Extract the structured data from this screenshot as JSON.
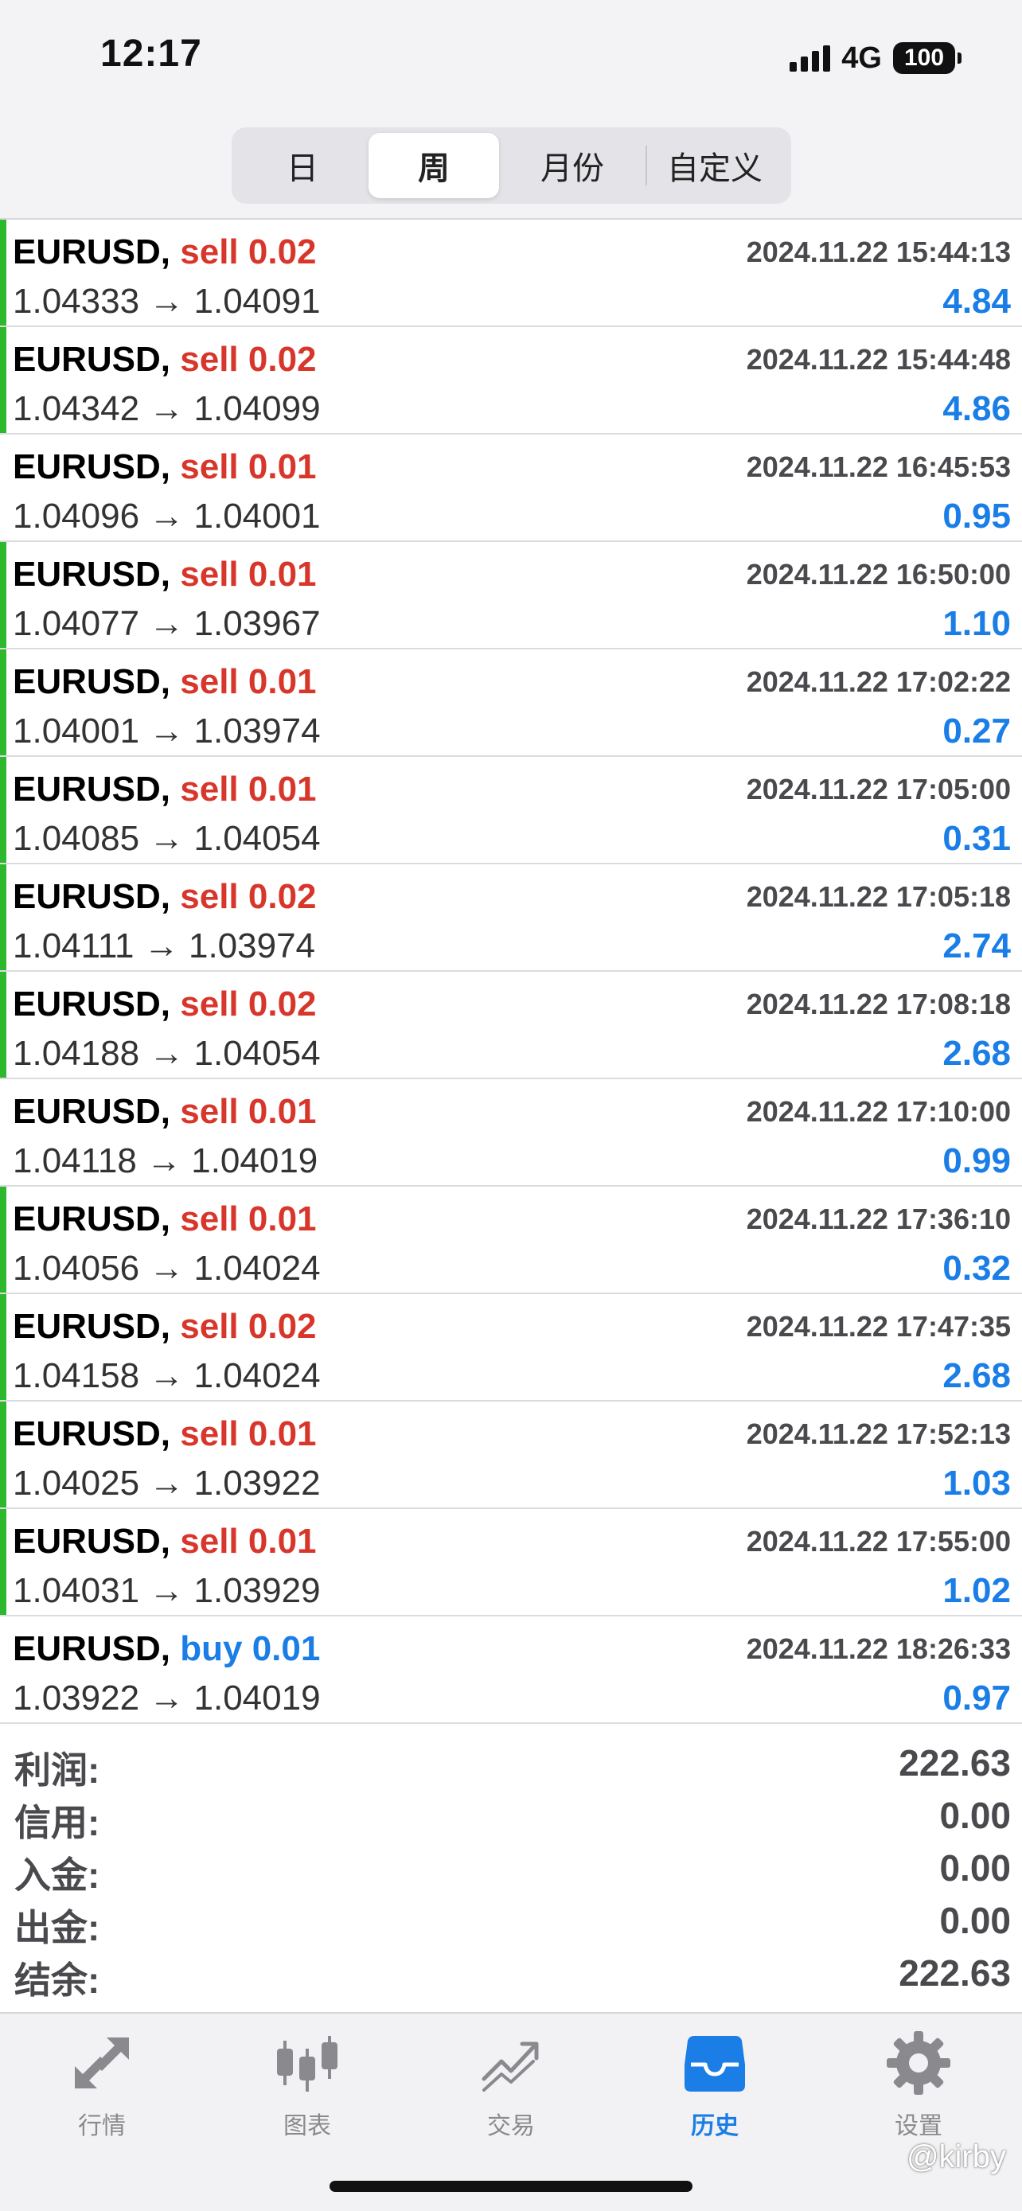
{
  "status_bar": {
    "time": "12:17",
    "network": "4G",
    "battery": "100"
  },
  "period_tabs": [
    {
      "label": "日",
      "active": false
    },
    {
      "label": "周",
      "active": true
    },
    {
      "label": "月份",
      "active": false
    },
    {
      "label": "自定义",
      "active": false
    }
  ],
  "trades": [
    {
      "symbol": "EURUSD,",
      "side": "sell 0.02",
      "time": "2024.11.22 15:44:13",
      "prices": "1.04333 → 1.04091",
      "profit": "4.84",
      "bar": true
    },
    {
      "symbol": "EURUSD,",
      "side": "sell 0.02",
      "time": "2024.11.22 15:44:48",
      "prices": "1.04342 → 1.04099",
      "profit": "4.86",
      "bar": true
    },
    {
      "symbol": "EURUSD,",
      "side": "sell 0.01",
      "time": "2024.11.22 16:45:53",
      "prices": "1.04096 → 1.04001",
      "profit": "0.95",
      "bar": false
    },
    {
      "symbol": "EURUSD,",
      "side": "sell 0.01",
      "time": "2024.11.22 16:50:00",
      "prices": "1.04077 → 1.03967",
      "profit": "1.10",
      "bar": true
    },
    {
      "symbol": "EURUSD,",
      "side": "sell 0.01",
      "time": "2024.11.22 17:02:22",
      "prices": "1.04001 → 1.03974",
      "profit": "0.27",
      "bar": true
    },
    {
      "symbol": "EURUSD,",
      "side": "sell 0.01",
      "time": "2024.11.22 17:05:00",
      "prices": "1.04085 → 1.04054",
      "profit": "0.31",
      "bar": true
    },
    {
      "symbol": "EURUSD,",
      "side": "sell 0.02",
      "time": "2024.11.22 17:05:18",
      "prices": "1.04111 → 1.03974",
      "profit": "2.74",
      "bar": true
    },
    {
      "symbol": "EURUSD,",
      "side": "sell 0.02",
      "time": "2024.11.22 17:08:18",
      "prices": "1.04188 → 1.04054",
      "profit": "2.68",
      "bar": true
    },
    {
      "symbol": "EURUSD,",
      "side": "sell 0.01",
      "time": "2024.11.22 17:10:00",
      "prices": "1.04118 → 1.04019",
      "profit": "0.99",
      "bar": false
    },
    {
      "symbol": "EURUSD,",
      "side": "sell 0.01",
      "time": "2024.11.22 17:36:10",
      "prices": "1.04056 → 1.04024",
      "profit": "0.32",
      "bar": true
    },
    {
      "symbol": "EURUSD,",
      "side": "sell 0.02",
      "time": "2024.11.22 17:47:35",
      "prices": "1.04158 → 1.04024",
      "profit": "2.68",
      "bar": true
    },
    {
      "symbol": "EURUSD,",
      "side": "sell 0.01",
      "time": "2024.11.22 17:52:13",
      "prices": "1.04025 → 1.03922",
      "profit": "1.03",
      "bar": true
    },
    {
      "symbol": "EURUSD,",
      "side": "sell 0.01",
      "time": "2024.11.22 17:55:00",
      "prices": "1.04031 → 1.03929",
      "profit": "1.02",
      "bar": true
    },
    {
      "symbol": "EURUSD,",
      "side": "buy 0.01",
      "time": "2024.11.22 18:26:33",
      "prices": "1.03922 → 1.04019",
      "profit": "0.97",
      "bar": false
    }
  ],
  "summary": [
    {
      "label": "利润:",
      "value": "222.63"
    },
    {
      "label": "信用:",
      "value": "0.00"
    },
    {
      "label": "入金:",
      "value": "0.00"
    },
    {
      "label": "出金:",
      "value": "0.00"
    },
    {
      "label": "结余:",
      "value": "222.63"
    }
  ],
  "tabbar": [
    {
      "label": "行情",
      "icon": "quotes-arrows-icon",
      "active": false
    },
    {
      "label": "图表",
      "icon": "candlestick-chart-icon",
      "active": false
    },
    {
      "label": "交易",
      "icon": "trade-chart-icon",
      "active": false
    },
    {
      "label": "历史",
      "icon": "history-inbox-icon",
      "active": true
    },
    {
      "label": "设置",
      "icon": "gear-icon",
      "active": false
    }
  ],
  "watermark": "@kirby",
  "colors": {
    "sell": "#d8362b",
    "buy": "#1a7ee6",
    "profit": "#1a7ee6",
    "bar": "#2db82d",
    "active_tab": "#1a7ee6",
    "inactive_tab": "#8a8a8e"
  }
}
